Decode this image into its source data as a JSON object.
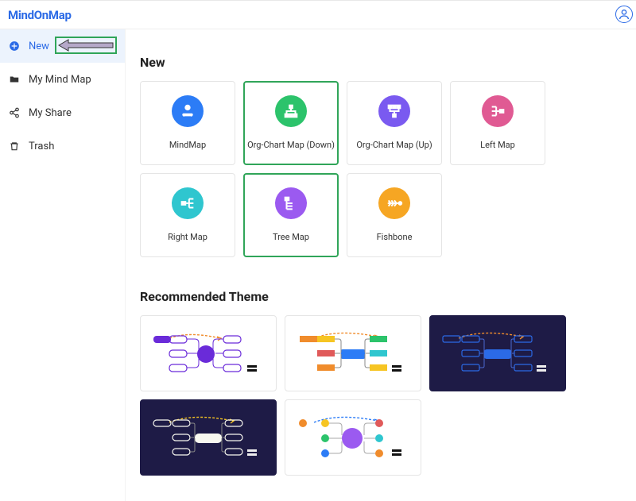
{
  "logo": {
    "text": "MindOnMap"
  },
  "sidebar": {
    "items": [
      {
        "label": "New"
      },
      {
        "label": "My Mind Map"
      },
      {
        "label": "My Share"
      },
      {
        "label": "Trash"
      }
    ]
  },
  "main": {
    "new_title": "New",
    "templates": [
      {
        "label": "MindMap",
        "color": "#2c7cf6"
      },
      {
        "label": "Org-Chart Map (Down)",
        "color": "#2cc36b"
      },
      {
        "label": "Org-Chart Map (Up)",
        "color": "#7a5af0"
      },
      {
        "label": "Left Map",
        "color": "#e05a93"
      },
      {
        "label": "Right Map",
        "color": "#2fc6cf"
      },
      {
        "label": "Tree Map",
        "color": "#9b5af0"
      },
      {
        "label": "Fishbone",
        "color": "#f6a623"
      }
    ],
    "recommended_title": "Recommended Theme"
  },
  "colors": {
    "theme_purple": "#6a2bd9",
    "theme_blue": "#2c7cf6",
    "theme_orange": "#f08c2c",
    "theme_green": "#2cc36b",
    "theme_yellow": "#f6c523",
    "theme_red": "#e05a5a",
    "theme_violet": "#9b5af0",
    "dark_bg": "#1e1b46"
  }
}
